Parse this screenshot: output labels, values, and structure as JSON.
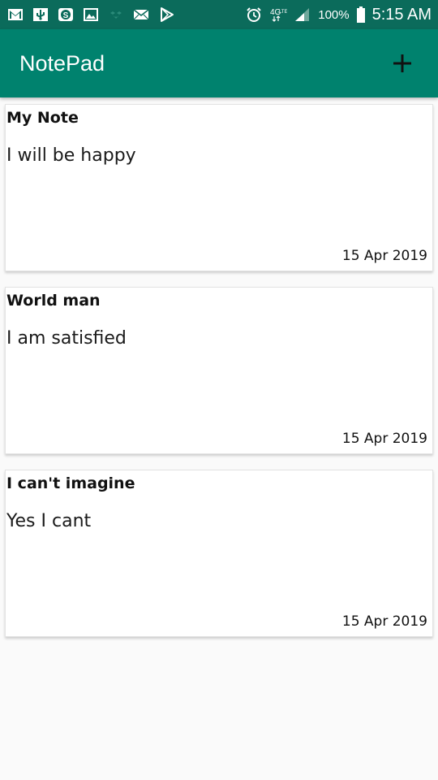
{
  "status_bar": {
    "icons": [
      "gmail-icon",
      "usb-icon",
      "s-app-icon",
      "image-icon",
      "dropbox-icon",
      "mail-icon",
      "play-store-icon",
      "alarm-icon",
      "4g-lte-icon",
      "signal-icon"
    ],
    "battery_text": "100%",
    "time": "5:15 AM",
    "bg_color": "#0b6b5b"
  },
  "app_bar": {
    "title": "NotePad",
    "add_icon": "plus-icon",
    "bg_color": "#00826e"
  },
  "notes": [
    {
      "title": "My Note",
      "body": "I will be happy",
      "date": "15 Apr 2019"
    },
    {
      "title": "World man",
      "body": "I am satisfied",
      "date": "15 Apr 2019"
    },
    {
      "title": "I can't imagine",
      "body": "Yes I cant",
      "date": "15 Apr 2019"
    }
  ]
}
